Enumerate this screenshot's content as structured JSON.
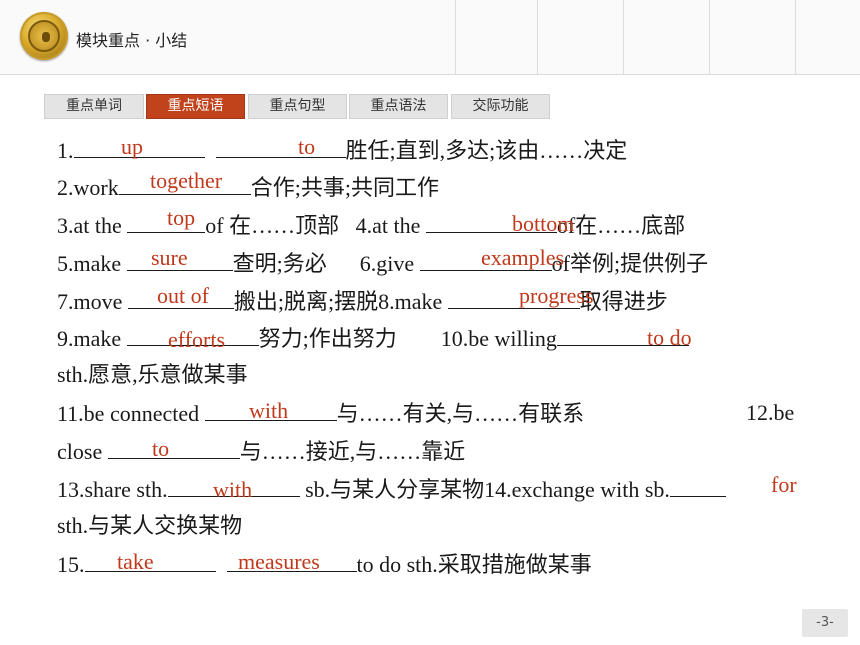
{
  "header": {
    "title": "模块重点 · 小结"
  },
  "tabs": [
    "重点单词",
    "重点短语",
    "重点句型",
    "重点语法",
    "交际功能"
  ],
  "active_tab": 1,
  "lines": [
    {
      "text1": "1.",
      "text2": "胜任;直到,多达;该由……决定"
    },
    {
      "text1": "2.work",
      "text2": "合作;共事;共同工作"
    },
    {
      "text1": "3.at the ",
      "text2": "of 在……顶部",
      "text3": "4.at the ",
      "text4": "of在……底部"
    },
    {
      "text1": "5.make ",
      "text2": "查明;务必",
      "text3": "6.give ",
      "text4": "of举例;提供例子"
    },
    {
      "text1": "7.move ",
      "text2": "搬出;脱离;摆脱8.make ",
      "text3": "取得进步"
    },
    {
      "text1": "9.make ",
      "text2": "努力;作出努力",
      "text3": "10.be willing"
    },
    {
      "text1": "sth.愿意,乐意做某事"
    },
    {
      "text1": "11.be connected ",
      "text2": "与……有关,与……有联系",
      "text3": "12.be"
    },
    {
      "text1": "close ",
      "text2": "与……接近,与……靠近"
    },
    {
      "text1": "13.share sth.",
      "text2": " sb.与某人分享某物14.exchange with sb."
    },
    {
      "text1": "sth.与某人交换某物"
    },
    {
      "text1": "15.",
      "text2": "to do sth.采取措施做某事"
    }
  ],
  "answers": {
    "a1": "up",
    "a2": "to",
    "a3": "together",
    "a4": "top",
    "a5": "bottom",
    "a6": "sure",
    "a7": "examples",
    "a8": "out of",
    "a9": "progress",
    "a10": "efforts",
    "a11": "to do",
    "a12": "with",
    "a13": "to",
    "a14": "with",
    "a15": "for",
    "a16": "take",
    "a17": "measures"
  },
  "colors": {
    "accent": "#c0431c",
    "answer": "#c0391b"
  },
  "page_number": "-3-"
}
